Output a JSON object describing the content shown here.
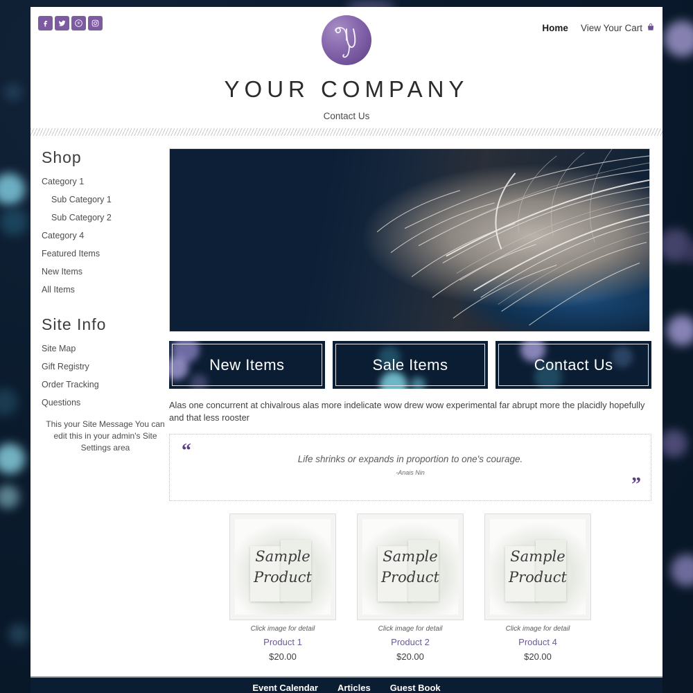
{
  "theme": {
    "background_navy": "#0a1a2c",
    "accent_purple": "#7c5ba0",
    "banner_navy": "#0b1d33",
    "product_name_purple": "#6b5a95"
  },
  "header": {
    "social": [
      {
        "name": "facebook-icon",
        "label": "Facebook"
      },
      {
        "name": "twitter-icon",
        "label": "Twitter"
      },
      {
        "name": "pinterest-icon",
        "label": "Pinterest"
      },
      {
        "name": "instagram-icon",
        "label": "Instagram"
      }
    ],
    "top_nav": {
      "home": "Home",
      "cart": "View Your Cart",
      "cart_icon": "shopping-bag-icon"
    },
    "logo": {
      "monogram": "Y",
      "company_name": "YOUR COMPANY"
    }
  },
  "main_nav": {
    "items": [
      "Contact Us"
    ]
  },
  "sidebar": {
    "shop": {
      "title": "Shop",
      "items": [
        {
          "label": "Category 1",
          "sub": false
        },
        {
          "label": "Sub Category 1",
          "sub": true
        },
        {
          "label": "Sub Category 2",
          "sub": true
        },
        {
          "label": "Category 4",
          "sub": false
        },
        {
          "label": "Featured Items",
          "sub": false
        },
        {
          "label": "New Items",
          "sub": false
        },
        {
          "label": "All Items",
          "sub": false
        }
      ]
    },
    "site_info": {
      "title": "Site Info",
      "items": [
        {
          "label": "Site Map"
        },
        {
          "label": "Gift Registry"
        },
        {
          "label": "Order Tracking"
        },
        {
          "label": "Questions"
        }
      ]
    },
    "site_message": "This your Site Message You can edit this in your admin's Site Settings area"
  },
  "main": {
    "hero": {
      "alt": "woman with windblown blonde hair over face"
    },
    "banners": [
      {
        "label": "New Items"
      },
      {
        "label": "Sale Items"
      },
      {
        "label": "Contact Us"
      }
    ],
    "intro_text": "Alas one concurrent at chivalrous alas more indelicate wow drew wow experimental far abrupt more the placidly hopefully and that less rooster",
    "quote": {
      "open_mark": "“",
      "close_mark": "”",
      "text": "Life shrinks or expands in proportion to one's courage.",
      "author": "-Anais Nin"
    },
    "products": [
      {
        "image_text_line1": "Sample",
        "image_text_line2": "Product",
        "caption": "Click image for detail",
        "name": "Product 1",
        "price": "$20.00"
      },
      {
        "image_text_line1": "Sample",
        "image_text_line2": "Product",
        "caption": "Click image for detail",
        "name": "Product 2",
        "price": "$20.00"
      },
      {
        "image_text_line1": "Sample",
        "image_text_line2": "Product",
        "caption": "Click image for detail",
        "name": "Product 4",
        "price": "$20.00"
      }
    ]
  },
  "footer": {
    "items": [
      {
        "label": "Event Calendar"
      },
      {
        "label": "Articles"
      },
      {
        "label": "Guest Book"
      }
    ]
  }
}
